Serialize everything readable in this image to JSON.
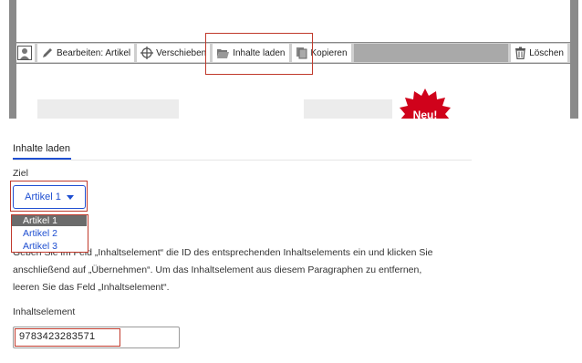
{
  "toolbar": {
    "edit_label": "Bearbeiten: Artikel",
    "move_label": "Verschieben",
    "load_label": "Inhalte laden",
    "copy_label": "Kopieren",
    "delete_label": "Löschen"
  },
  "badge": {
    "label": "Neu!",
    "color": "#d0021b"
  },
  "tabs": [
    {
      "label": "Inhalte laden",
      "active": true
    }
  ],
  "form": {
    "target_label": "Ziel",
    "target_selected": "Artikel 1",
    "target_options": [
      "Artikel 1",
      "Artikel 2",
      "Artikel 3"
    ],
    "description_line1": "Geben Sie im Feld „Inhaltselement“ die ID des entsprechenden Inhaltselements ein und klicken Sie",
    "description_line2": "anschließend auf „Übernehmen“. Um das Inhaltselement aus diesem Paragraphen zu entfernen,",
    "description_line3": "leeren Sie das Feld „Inhaltselement“.",
    "content_label": "Inhaltselement",
    "content_value": "9783423283571"
  },
  "colors": {
    "accent": "#1f4fd1",
    "highlight": "#c0392b",
    "frame": "#8a8a8a"
  }
}
